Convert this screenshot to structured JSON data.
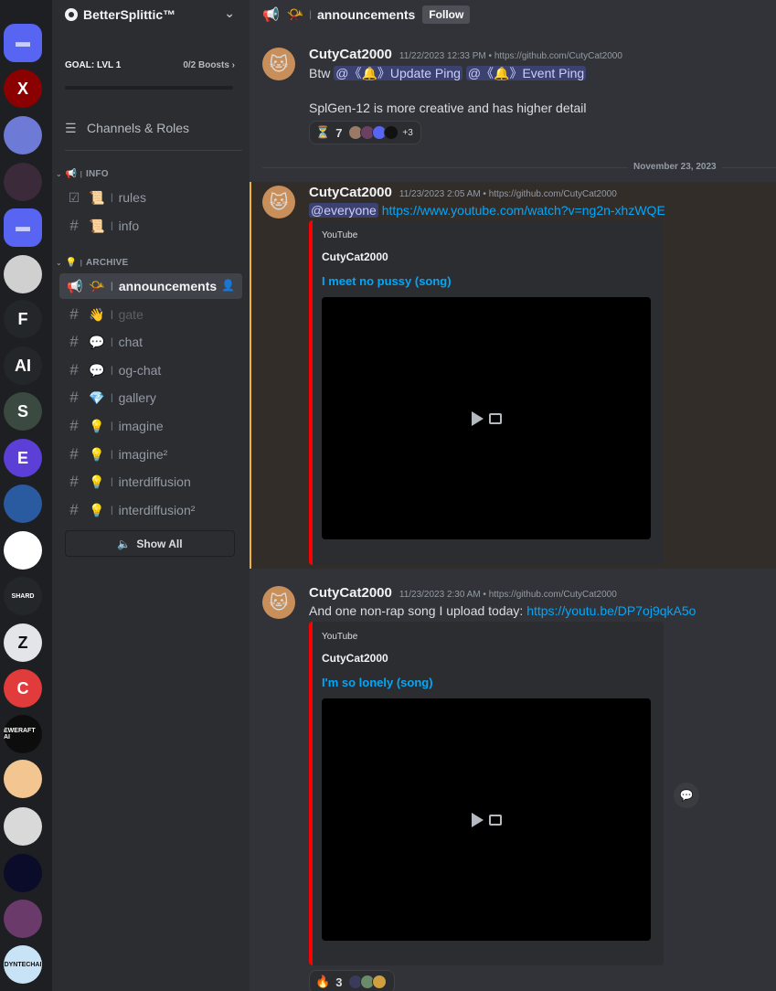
{
  "servers": [
    {
      "name": "folder",
      "label": "",
      "color": "#5865f2",
      "shape": "square"
    },
    {
      "name": "server-splitics",
      "label": "X",
      "color": "#8b0000"
    },
    {
      "name": "server-avatar-girl",
      "label": "",
      "color": "#6d7bd6"
    },
    {
      "name": "server-skull",
      "label": "",
      "color": "#3a2a3a"
    },
    {
      "name": "folder-2",
      "label": "",
      "color": "#5865f2",
      "shape": "square"
    },
    {
      "name": "server-dragon",
      "label": "",
      "color": "#d0d0d0"
    },
    {
      "name": "server-f",
      "label": "F",
      "color": "#23272a"
    },
    {
      "name": "server-hecker-ai",
      "label": "AI",
      "color": "#23272a"
    },
    {
      "name": "server-s",
      "label": "S",
      "color": "#3a4a40"
    },
    {
      "name": "server-e",
      "label": "E",
      "color": "#5b3fd6"
    },
    {
      "name": "server-blue",
      "label": "",
      "color": "#2a5aa0"
    },
    {
      "name": "server-shark",
      "label": "",
      "color": "#ffffff"
    },
    {
      "name": "server-shard",
      "label": "SHARD",
      "color": "#23272a"
    },
    {
      "name": "server-z",
      "label": "Z",
      "color": "#e3e5e8"
    },
    {
      "name": "server-c",
      "label": "C",
      "color": "#e23b3b"
    },
    {
      "name": "server-eweraft",
      "label": "EWERAFT AI",
      "color": "#0d0d0d"
    },
    {
      "name": "server-openai",
      "label": "",
      "color": "#f3c691"
    },
    {
      "name": "server-star",
      "label": "",
      "color": "#d9d9d9"
    },
    {
      "name": "server-piermark",
      "label": "",
      "color": "#0b0b2a"
    },
    {
      "name": "server-lotus",
      "label": "",
      "color": "#6a3a6a"
    },
    {
      "name": "server-dyntechai",
      "label": "DYNTECHAI",
      "color": "#c7e3f5"
    }
  ],
  "guild": {
    "name": "BetterSplittic™"
  },
  "boost": {
    "goal": "GOAL: LVL 1",
    "progress": "0/2 Boosts",
    "fill": 0
  },
  "channels_roles": "Channels & Roles",
  "categories": {
    "info": "INFO",
    "archive": "ARCHIVE"
  },
  "channels": [
    {
      "name": "rules",
      "emoji": "📜",
      "icon": "rules-checkbox-icon"
    },
    {
      "name": "info",
      "emoji": "📜",
      "icon": "hash-icon"
    },
    {
      "name": "announcements",
      "emoji": "📯",
      "icon": "megaphone-icon",
      "active": true
    },
    {
      "name": "gate",
      "emoji": "👋",
      "icon": "hash-icon",
      "muted": true
    },
    {
      "name": "chat",
      "emoji": "💬",
      "icon": "hash-icon"
    },
    {
      "name": "og-chat",
      "emoji": "💬",
      "icon": "hash-icon"
    },
    {
      "name": "gallery",
      "emoji": "💎",
      "icon": "hash-icon"
    },
    {
      "name": "imagine",
      "emoji": "💡",
      "icon": "hash-icon"
    },
    {
      "name": "imagine²",
      "emoji": "💡",
      "icon": "hash-icon"
    },
    {
      "name": "interdiffusion",
      "emoji": "💡",
      "icon": "hash-icon"
    },
    {
      "name": "interdiffusion²",
      "emoji": "💡",
      "icon": "hash-icon"
    }
  ],
  "show_all": "Show All",
  "topbar": {
    "channel": "announcements",
    "emoji": "📯",
    "follow": "Follow"
  },
  "messages": [
    {
      "author": "CutyCat2000",
      "timestamp": "11/22/2023 12:33 PM • https://github.com/CutyCat2000",
      "line1_prefix": "Btw ",
      "ping1": "@《🔔》Update Ping",
      "ping2": "@《🔔》Event Ping",
      "line2": "SplGen-12 is more creative and has higher detail",
      "reaction_count": "7",
      "reaction_more": "+3"
    },
    {
      "author": "CutyCat2000",
      "timestamp": "11/23/2023 2:05 AM • https://github.com/CutyCat2000",
      "mention": "@everyone",
      "link": "https://www.youtube.com/watch?v=ng2n-xhzWQE",
      "embed": {
        "provider": "YouTube",
        "author": "CutyCat2000",
        "title": "I meet no pussy (song)"
      }
    },
    {
      "author": "CutyCat2000",
      "timestamp": "11/23/2023 2:30 AM • https://github.com/CutyCat2000",
      "text": "And one non-rap song I upload today: ",
      "link": "https://youtu.be/DP7oj9qkA5o",
      "embed": {
        "provider": "YouTube",
        "author": "CutyCat2000",
        "title": "I'm so lonely (song)"
      },
      "reaction_count": "3"
    }
  ],
  "date_separator": "November 23, 2023"
}
